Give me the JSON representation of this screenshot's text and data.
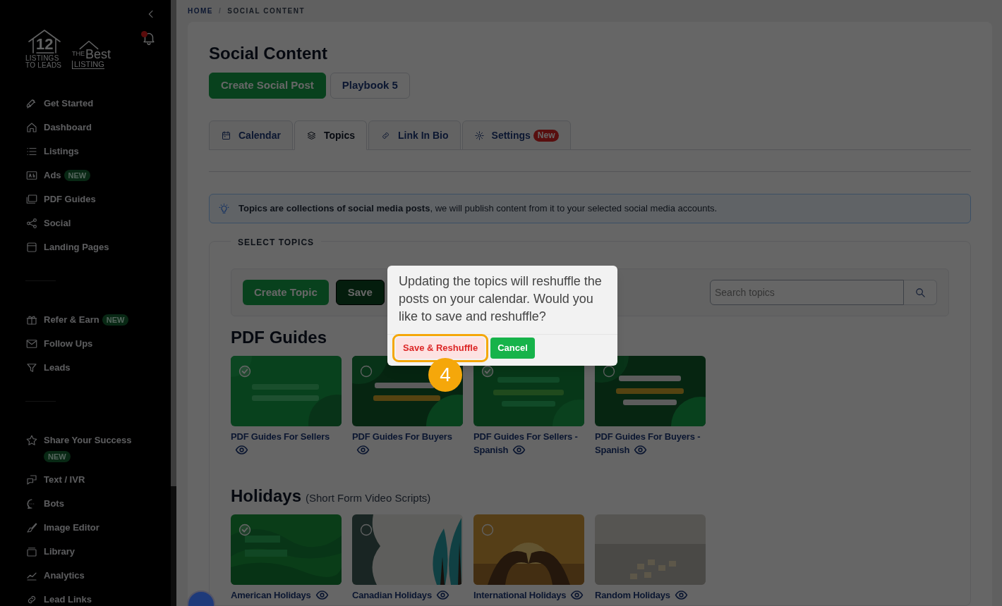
{
  "sidebar": {
    "logos": [
      {
        "mark": "12",
        "lines": [
          "LISTINGS",
          "TO LEADS"
        ]
      },
      {
        "prefix": "THE",
        "word": "Best",
        "lines": [
          "LISTING"
        ]
      }
    ],
    "notifications": {
      "unread": true
    },
    "groups": [
      {
        "items": [
          {
            "label": "Get Started"
          },
          {
            "label": "Dashboard"
          },
          {
            "label": "Listings"
          },
          {
            "label": "Ads",
            "badge": "NEW"
          },
          {
            "label": "PDF Guides"
          },
          {
            "label": "Social"
          },
          {
            "label": "Landing Pages"
          }
        ]
      },
      {
        "items": [
          {
            "label": "Refer & Earn",
            "badge": "NEW"
          },
          {
            "label": "Follow Ups"
          },
          {
            "label": "Leads"
          }
        ]
      },
      {
        "items": [
          {
            "label": "Share Your Success",
            "badge": "NEW"
          },
          {
            "label": "Text / IVR"
          },
          {
            "label": "Bots"
          },
          {
            "label": "Image Editor"
          },
          {
            "label": "Library"
          },
          {
            "label": "Analytics"
          },
          {
            "label": "Lead Links"
          }
        ]
      }
    ]
  },
  "breadcrumb": {
    "separator": "/",
    "items": [
      "HOME",
      "SOCIAL CONTENT"
    ]
  },
  "page": {
    "title": "Social Content",
    "buttons": [
      {
        "label": "Create Social Post",
        "kind": "primary"
      },
      {
        "label": "Playbook 5",
        "kind": "outline"
      }
    ],
    "tabs": [
      {
        "label": "Calendar",
        "selected": false
      },
      {
        "label": "Topics",
        "selected": true
      },
      {
        "label": "Link In Bio",
        "selected": false
      },
      {
        "label": "Settings",
        "badge": "New",
        "selected": false
      }
    ],
    "info": "**Topics are collections of social media posts**, we will publish content from it to your selected social media accounts.",
    "topics_panel": {
      "legend": "SELECT TOPICS",
      "buttons": [
        {
          "label": "Create Topic",
          "kind": "primary"
        },
        {
          "label": "Save",
          "kind": "dark"
        }
      ],
      "search": {
        "placeholder": "Search topics"
      },
      "sections": [
        {
          "title": "PDF Guides",
          "topics": [
            {
              "name": "PDF Guides For Sellers",
              "selected": true
            },
            {
              "name": "PDF Guides For Buyers",
              "selected": false
            },
            {
              "name": "PDF Guides For Sellers - Spanish",
              "selected": true
            },
            {
              "name": "PDF Guides For Buyers - Spanish",
              "selected": false
            }
          ]
        },
        {
          "title": "Holidays",
          "subtitle": "(Short Form Video Scripts)",
          "topics": [
            {
              "name": "American Holidays",
              "selected": true
            },
            {
              "name": "Canadian Holidays",
              "selected": false
            },
            {
              "name": "International Holidays",
              "selected": false
            },
            {
              "name": "Random Holidays"
            }
          ]
        }
      ]
    }
  },
  "dialog": {
    "message": "Updating the topics will reshuffle the posts on your calendar. Would you like to save and reshuffle?",
    "buttons": [
      {
        "label": "Save & Reshuffle",
        "kind": "danger",
        "highlighted": true
      },
      {
        "label": "Cancel",
        "kind": "success",
        "highlighted": false
      }
    ],
    "step_badge": "4"
  }
}
